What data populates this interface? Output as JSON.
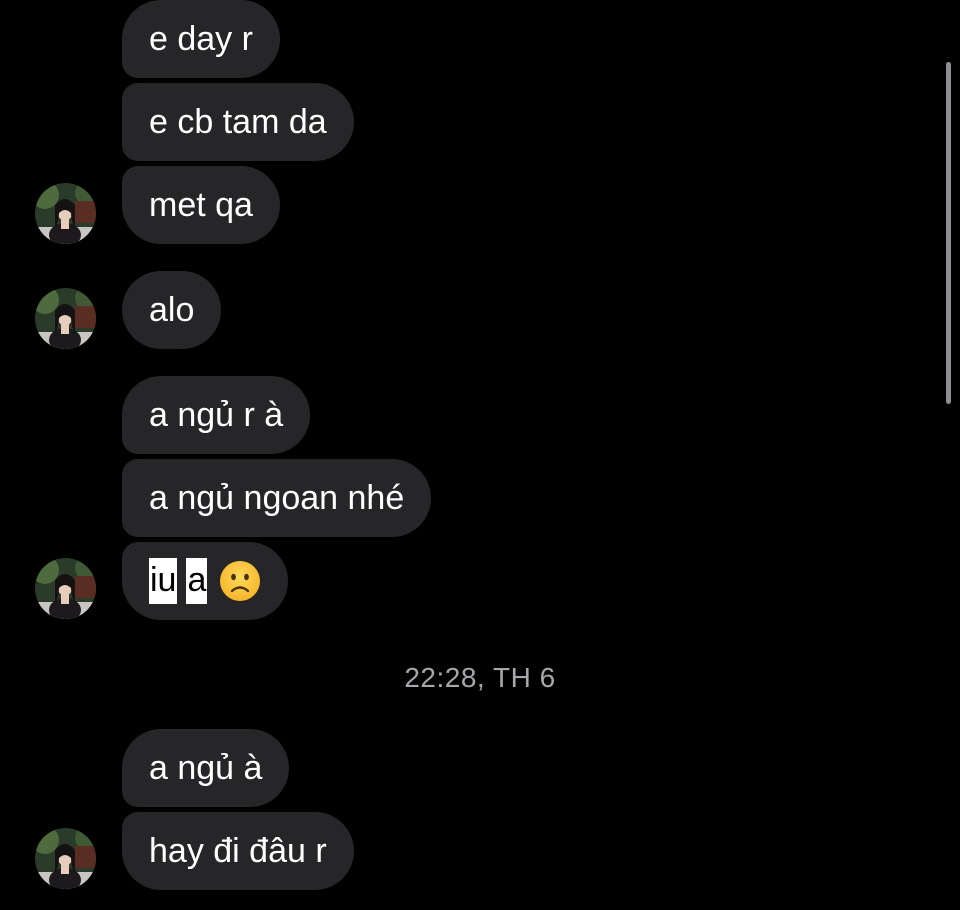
{
  "messages": [
    {
      "text": "e day r"
    },
    {
      "text": "e cb tam da"
    },
    {
      "text": "met qa"
    },
    {
      "text": "alo"
    },
    {
      "text": "a ngủ r à"
    },
    {
      "text": "a ngủ ngoan nhé"
    },
    {
      "text_part_1": "iu",
      "text_part_2": "a",
      "emoji": "slightly-frowning-face"
    },
    {
      "text": "a ngủ à"
    },
    {
      "text": "hay đi đâu r"
    }
  ],
  "timestamp": "22:28, TH 6",
  "colors": {
    "background": "#000000",
    "bubble": "#262628",
    "text": "#ffffff",
    "timestamp": "#a7a7ab",
    "highlight": "#ffffff",
    "scrollbar": "#8e8e93"
  },
  "avatar": {
    "icon": "contact-avatar-photo"
  }
}
